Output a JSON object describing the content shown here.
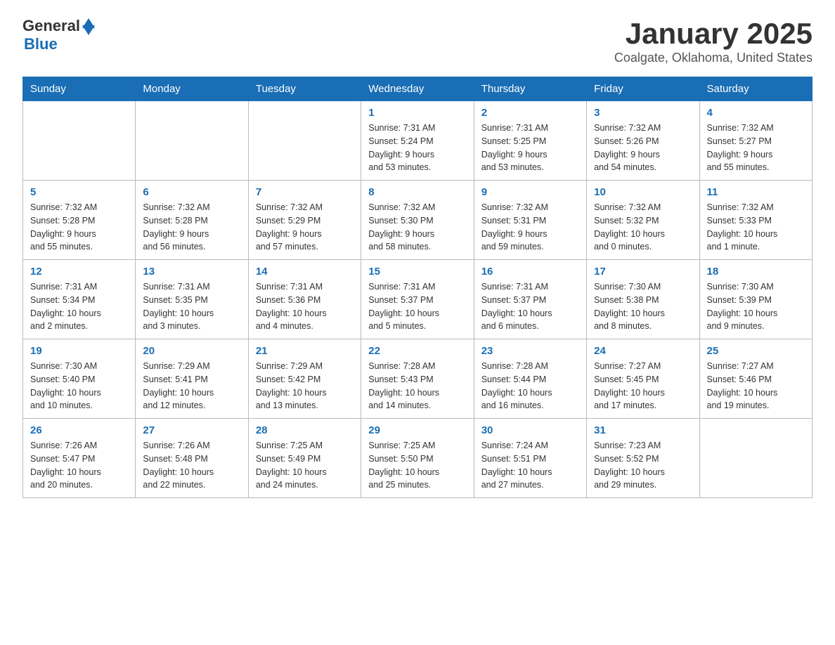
{
  "logo": {
    "text_general": "General",
    "text_blue": "Blue"
  },
  "header": {
    "month_title": "January 2025",
    "location": "Coalgate, Oklahoma, United States"
  },
  "weekdays": [
    "Sunday",
    "Monday",
    "Tuesday",
    "Wednesday",
    "Thursday",
    "Friday",
    "Saturday"
  ],
  "weeks": [
    [
      {
        "day": "",
        "info": ""
      },
      {
        "day": "",
        "info": ""
      },
      {
        "day": "",
        "info": ""
      },
      {
        "day": "1",
        "info": "Sunrise: 7:31 AM\nSunset: 5:24 PM\nDaylight: 9 hours\nand 53 minutes."
      },
      {
        "day": "2",
        "info": "Sunrise: 7:31 AM\nSunset: 5:25 PM\nDaylight: 9 hours\nand 53 minutes."
      },
      {
        "day": "3",
        "info": "Sunrise: 7:32 AM\nSunset: 5:26 PM\nDaylight: 9 hours\nand 54 minutes."
      },
      {
        "day": "4",
        "info": "Sunrise: 7:32 AM\nSunset: 5:27 PM\nDaylight: 9 hours\nand 55 minutes."
      }
    ],
    [
      {
        "day": "5",
        "info": "Sunrise: 7:32 AM\nSunset: 5:28 PM\nDaylight: 9 hours\nand 55 minutes."
      },
      {
        "day": "6",
        "info": "Sunrise: 7:32 AM\nSunset: 5:28 PM\nDaylight: 9 hours\nand 56 minutes."
      },
      {
        "day": "7",
        "info": "Sunrise: 7:32 AM\nSunset: 5:29 PM\nDaylight: 9 hours\nand 57 minutes."
      },
      {
        "day": "8",
        "info": "Sunrise: 7:32 AM\nSunset: 5:30 PM\nDaylight: 9 hours\nand 58 minutes."
      },
      {
        "day": "9",
        "info": "Sunrise: 7:32 AM\nSunset: 5:31 PM\nDaylight: 9 hours\nand 59 minutes."
      },
      {
        "day": "10",
        "info": "Sunrise: 7:32 AM\nSunset: 5:32 PM\nDaylight: 10 hours\nand 0 minutes."
      },
      {
        "day": "11",
        "info": "Sunrise: 7:32 AM\nSunset: 5:33 PM\nDaylight: 10 hours\nand 1 minute."
      }
    ],
    [
      {
        "day": "12",
        "info": "Sunrise: 7:31 AM\nSunset: 5:34 PM\nDaylight: 10 hours\nand 2 minutes."
      },
      {
        "day": "13",
        "info": "Sunrise: 7:31 AM\nSunset: 5:35 PM\nDaylight: 10 hours\nand 3 minutes."
      },
      {
        "day": "14",
        "info": "Sunrise: 7:31 AM\nSunset: 5:36 PM\nDaylight: 10 hours\nand 4 minutes."
      },
      {
        "day": "15",
        "info": "Sunrise: 7:31 AM\nSunset: 5:37 PM\nDaylight: 10 hours\nand 5 minutes."
      },
      {
        "day": "16",
        "info": "Sunrise: 7:31 AM\nSunset: 5:37 PM\nDaylight: 10 hours\nand 6 minutes."
      },
      {
        "day": "17",
        "info": "Sunrise: 7:30 AM\nSunset: 5:38 PM\nDaylight: 10 hours\nand 8 minutes."
      },
      {
        "day": "18",
        "info": "Sunrise: 7:30 AM\nSunset: 5:39 PM\nDaylight: 10 hours\nand 9 minutes."
      }
    ],
    [
      {
        "day": "19",
        "info": "Sunrise: 7:30 AM\nSunset: 5:40 PM\nDaylight: 10 hours\nand 10 minutes."
      },
      {
        "day": "20",
        "info": "Sunrise: 7:29 AM\nSunset: 5:41 PM\nDaylight: 10 hours\nand 12 minutes."
      },
      {
        "day": "21",
        "info": "Sunrise: 7:29 AM\nSunset: 5:42 PM\nDaylight: 10 hours\nand 13 minutes."
      },
      {
        "day": "22",
        "info": "Sunrise: 7:28 AM\nSunset: 5:43 PM\nDaylight: 10 hours\nand 14 minutes."
      },
      {
        "day": "23",
        "info": "Sunrise: 7:28 AM\nSunset: 5:44 PM\nDaylight: 10 hours\nand 16 minutes."
      },
      {
        "day": "24",
        "info": "Sunrise: 7:27 AM\nSunset: 5:45 PM\nDaylight: 10 hours\nand 17 minutes."
      },
      {
        "day": "25",
        "info": "Sunrise: 7:27 AM\nSunset: 5:46 PM\nDaylight: 10 hours\nand 19 minutes."
      }
    ],
    [
      {
        "day": "26",
        "info": "Sunrise: 7:26 AM\nSunset: 5:47 PM\nDaylight: 10 hours\nand 20 minutes."
      },
      {
        "day": "27",
        "info": "Sunrise: 7:26 AM\nSunset: 5:48 PM\nDaylight: 10 hours\nand 22 minutes."
      },
      {
        "day": "28",
        "info": "Sunrise: 7:25 AM\nSunset: 5:49 PM\nDaylight: 10 hours\nand 24 minutes."
      },
      {
        "day": "29",
        "info": "Sunrise: 7:25 AM\nSunset: 5:50 PM\nDaylight: 10 hours\nand 25 minutes."
      },
      {
        "day": "30",
        "info": "Sunrise: 7:24 AM\nSunset: 5:51 PM\nDaylight: 10 hours\nand 27 minutes."
      },
      {
        "day": "31",
        "info": "Sunrise: 7:23 AM\nSunset: 5:52 PM\nDaylight: 10 hours\nand 29 minutes."
      },
      {
        "day": "",
        "info": ""
      }
    ]
  ]
}
